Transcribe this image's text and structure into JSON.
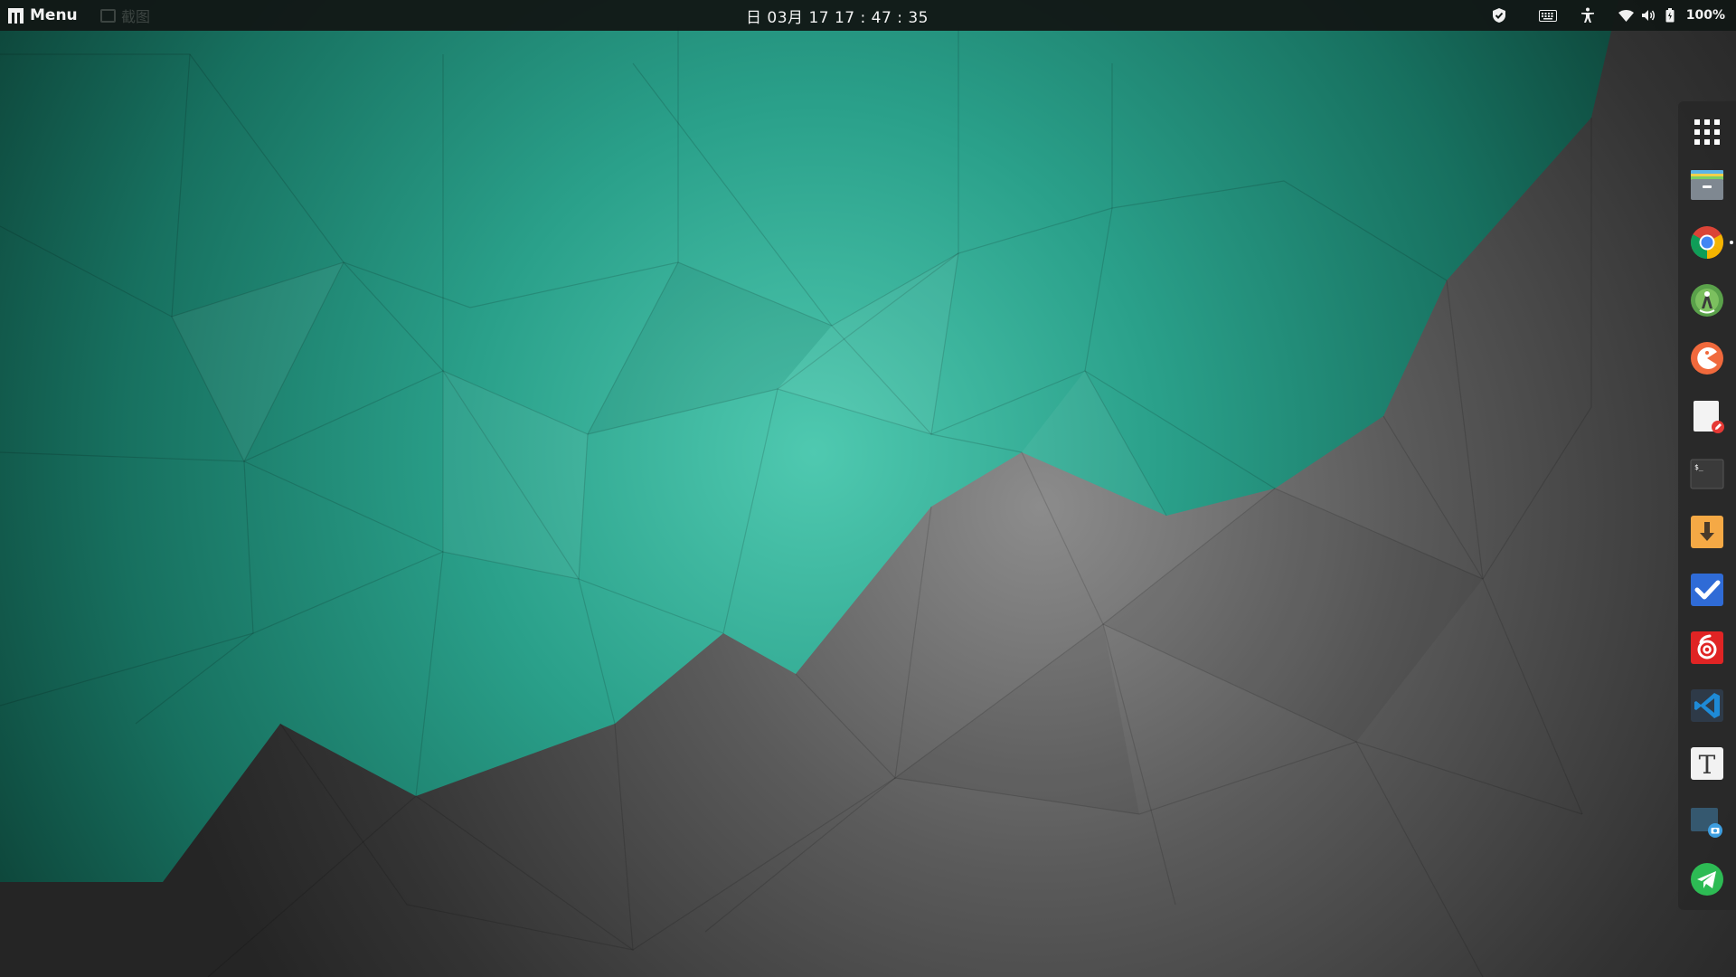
{
  "top_panel": {
    "menu_label": "Menu",
    "task_label": "截图",
    "clock": "日 03月 17  17 : 47 : 35",
    "battery_label": "100%",
    "tray_icons": [
      "shield-icon",
      "keyboard-icon",
      "accessibility-icon",
      "wifi-icon",
      "volume-icon",
      "battery-icon"
    ]
  },
  "dock": {
    "items": [
      {
        "name": "app-grid-icon",
        "label": "Show Applications"
      },
      {
        "name": "files-icon",
        "label": "Files"
      },
      {
        "name": "chrome-icon",
        "label": "Google Chrome",
        "running": true
      },
      {
        "name": "android-studio-icon",
        "label": "Android Studio"
      },
      {
        "name": "pacman-app-icon",
        "label": "App"
      },
      {
        "name": "text-editor-icon",
        "label": "Text Editor"
      },
      {
        "name": "terminal-icon",
        "label": "Terminal"
      },
      {
        "name": "download-icon",
        "label": "Downloader"
      },
      {
        "name": "tasks-check-icon",
        "label": "Tasks"
      },
      {
        "name": "netease-music-icon",
        "label": "NetEase Music"
      },
      {
        "name": "vscode-icon",
        "label": "Visual Studio Code"
      },
      {
        "name": "typora-icon",
        "label": "Typora"
      },
      {
        "name": "screenshot-icon",
        "label": "Screenshot"
      },
      {
        "name": "telegram-icon",
        "label": "Telegram"
      }
    ],
    "terminal_prompt": "$_",
    "typora_letter": "T"
  },
  "colors": {
    "panel_bg": "#121816",
    "teal_light": "#4ec7ad",
    "teal_dark": "#0d4c3e",
    "gray_light": "#8a8a8a",
    "gray_dark": "#2b2b2b",
    "dock_bg": "#282828"
  }
}
